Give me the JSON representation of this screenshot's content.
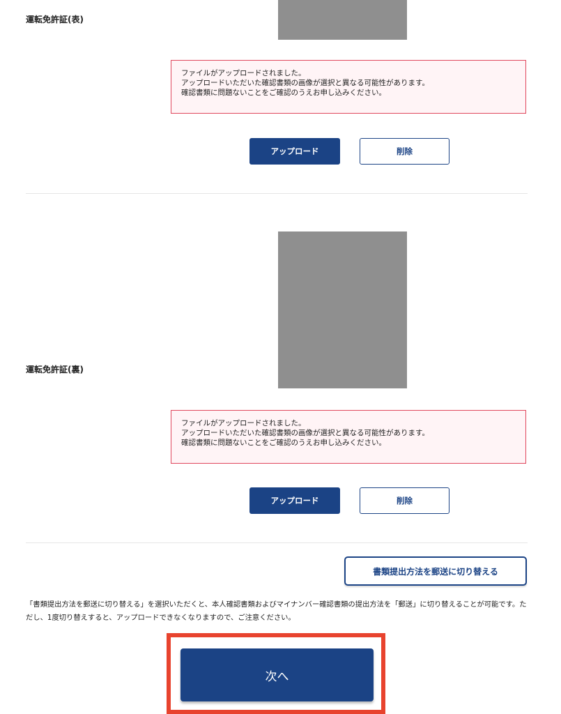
{
  "front": {
    "label": "運転免許証(表)",
    "notice": [
      "ファイルがアップロードされました。",
      "アップロードいただいた確認書類の画像が選択と異なる可能性があります。",
      "確認書類に問題ないことをご確認のうえお申し込みください。"
    ],
    "upload_label": "アップロード",
    "delete_label": "削除"
  },
  "back": {
    "label": "運転免許証(裏)",
    "notice": [
      "ファイルがアップロードされました。",
      "アップロードいただいた確認書類の画像が選択と異なる可能性があります。",
      "確認書類に問題ないことをご確認のうえお申し込みください。"
    ],
    "upload_label": "アップロード",
    "delete_label": "削除"
  },
  "switch_button_label": "書類提出方法を郵送に切り替える",
  "description": "「書類提出方法を郵送に切り替える」を選択いただくと、本人確認書類およびマイナンバー確認書類の提出方法を「郵送」に切り替えることが可能です。ただし、1度切り替えすると、アップロードできなくなりますので、ご注意ください。",
  "next_label": "次へ",
  "colors": {
    "primary": "#1b4385",
    "notice_border": "#e0465c",
    "notice_bg": "#fff4f6",
    "preview_gray": "#8f8f8f",
    "highlight": "#e8432e"
  }
}
